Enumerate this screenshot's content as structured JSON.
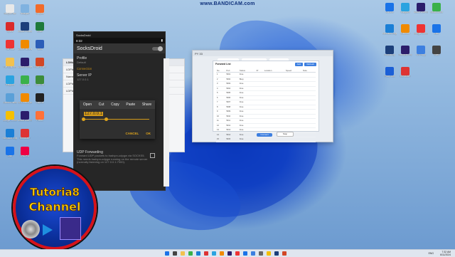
{
  "watermark": "www.BANDICAM.com",
  "desktop_left_icons": [
    "Recycle Bin",
    "Opera",
    "YouTube",
    "File Explorer",
    "Telegram",
    "Control Panel",
    "Google Chrome",
    "Microsoft Edge",
    "Zalo",
    "Notepad",
    "Adobe Photoshop",
    "Adobe Illustrator",
    "Adobe Premiere Pro",
    "LDPlayer",
    "VLC media player",
    "Adobe After Effects",
    "Bandicam",
    "AnyDesk",
    "Shopee",
    "Excel",
    "Word",
    "PowerPoint",
    "Coc Coc",
    "CapCut",
    "Firefox"
  ],
  "desktop_right_icons": [
    "Chrome",
    "Telegram",
    "Adobe After Effects",
    "Socks Droid",
    "Microsoft Edge",
    "Illustrator",
    "Google Chrome",
    "Zalo",
    "Photoshop",
    "Premiere Pro",
    "VN Proxy",
    "Video",
    "Proxy Tool",
    "Bandicam"
  ],
  "phone": {
    "window_title": "SocksDroid",
    "time": "8:32",
    "app_title": "SocksDroid",
    "profile_label": "Profile",
    "profile_value": "Default",
    "section_connection": "Connection",
    "server_ip_label": "Server IP",
    "server_ip_value": "127.0.0.1",
    "udp_label": "UDP Forwarding",
    "udp_desc": "Forward UDP packets to badvpn-udpgw via SOCKS5. This needs badvpn-udpgw running on the remote server (normally listening on 127.0.0.1:7300).",
    "dialog": {
      "menu": [
        "Open",
        "Cut",
        "Copy",
        "Paste",
        "Share"
      ],
      "input_value": "127.0.0.1",
      "cancel_label": "CANCEL",
      "ok_label": "OK"
    }
  },
  "ldplayer_list": {
    "title": "LDMultiPlayer",
    "rows": [
      "LDPlayer",
      "Name",
      "LDPlayer-1",
      "LDPlayer-2"
    ]
  },
  "proxy_app": {
    "window_title": "PY 33",
    "tabs": [
      "Still Have",
      "Local Proxy",
      "Local IP"
    ],
    "panel_title": "Forward List",
    "btn_add": "Add",
    "btn_refresh": "Refresh",
    "columns": [
      "No",
      "Port",
      "Status",
      "IP",
      "Location",
      "Speed",
      "Note"
    ],
    "rows": [
      [
        "1",
        "5001",
        "Free",
        "",
        "",
        "",
        ""
      ],
      [
        "2",
        "5002",
        "Busy",
        "",
        "",
        "",
        ""
      ],
      [
        "3",
        "5003",
        "Free",
        "",
        "",
        "",
        ""
      ],
      [
        "4",
        "5004",
        "Free",
        "",
        "",
        "",
        ""
      ],
      [
        "5",
        "5005",
        "Free",
        "",
        "",
        "",
        ""
      ],
      [
        "6",
        "5006",
        "Free",
        "",
        "",
        "",
        ""
      ],
      [
        "7",
        "5007",
        "Free",
        "",
        "",
        "",
        ""
      ],
      [
        "8",
        "5008",
        "Free",
        "",
        "",
        "",
        ""
      ],
      [
        "9",
        "5009",
        "Free",
        "",
        "",
        "",
        ""
      ],
      [
        "10",
        "5010",
        "Free",
        "",
        "",
        "",
        ""
      ],
      [
        "11",
        "5011",
        "Free",
        "",
        "",
        "",
        ""
      ],
      [
        "12",
        "5012",
        "Free",
        "",
        "",
        "",
        ""
      ],
      [
        "13",
        "5013",
        "Free",
        "",
        "",
        "",
        ""
      ],
      [
        "14",
        "5014",
        "Free",
        "",
        "",
        "",
        ""
      ],
      [
        "15",
        "5015",
        "Free",
        "",
        "",
        "",
        ""
      ]
    ],
    "footer_buttons": [
      "Connect",
      "Stop"
    ]
  },
  "logo": {
    "line1": "Tutoria8",
    "line2": "Channel"
  },
  "taskbar": {
    "time": "7:32 AM",
    "date": "6/11/2024",
    "lang": "ENG"
  },
  "colors": {
    "accent_orange": "#e0a51c",
    "proxy_blue": "#3d7fe0",
    "logo_red": "#d6121a",
    "logo_yellow": "#ffd400"
  }
}
